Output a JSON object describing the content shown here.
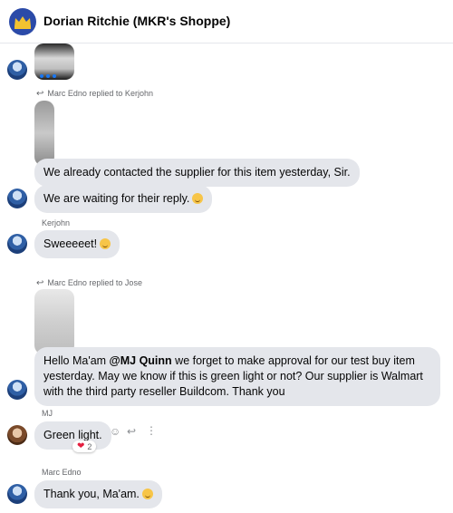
{
  "header": {
    "title": "Dorian Ritchie (MKR's Shoppe)"
  },
  "replies": [
    {
      "text": "Marc Edno replied to Kerjohn"
    },
    {
      "text": "Marc Edno replied to Jose"
    }
  ],
  "messages": [
    {
      "text": "We already contacted the supplier for this item yesterday, Sir."
    },
    {
      "text": "We are waiting for their reply."
    },
    {
      "sender": "Kerjohn",
      "text": "Sweeeeet!"
    },
    {
      "text_pre": "Hello Ma'am ",
      "mention": "@MJ Quinn",
      "text_post": " we forget to make approval for our test buy item yesterday. May we know if this is green light or not? Our supplier is Walmart with the third party reseller Buildcom. Thank you"
    },
    {
      "sender": "MJ",
      "text": "Green light.",
      "reaction_count": "2"
    },
    {
      "sender": "Marc Edno",
      "text": "Thank you, Ma'am."
    }
  ],
  "icons": {
    "reply": "reply-icon",
    "emoji": "smile-icon",
    "more": "more-icon",
    "heart": "heart-icon"
  },
  "colors": {
    "bubble": "#e4e6eb",
    "meta_text": "#65676b",
    "heart": "#e41e3f",
    "accent": "#1877f2"
  }
}
